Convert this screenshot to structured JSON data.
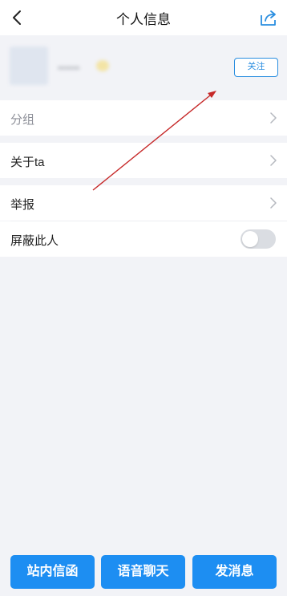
{
  "header": {
    "title": "个人信息",
    "back_icon": "chevron-left-icon",
    "share_icon": "share-icon"
  },
  "profile": {
    "username": "••••••",
    "follow_label": "关注"
  },
  "rows": {
    "group_label": "分组",
    "about_label": "关于ta",
    "report_label": "举报",
    "block_label": "屏蔽此人",
    "block_enabled": false
  },
  "bottom": {
    "mail_label": "站内信函",
    "voice_label": "语音聊天",
    "message_label": "发消息"
  },
  "colors": {
    "accent": "#1d8ef2",
    "background": "#f2f3f7",
    "annotation": "#c62828"
  }
}
